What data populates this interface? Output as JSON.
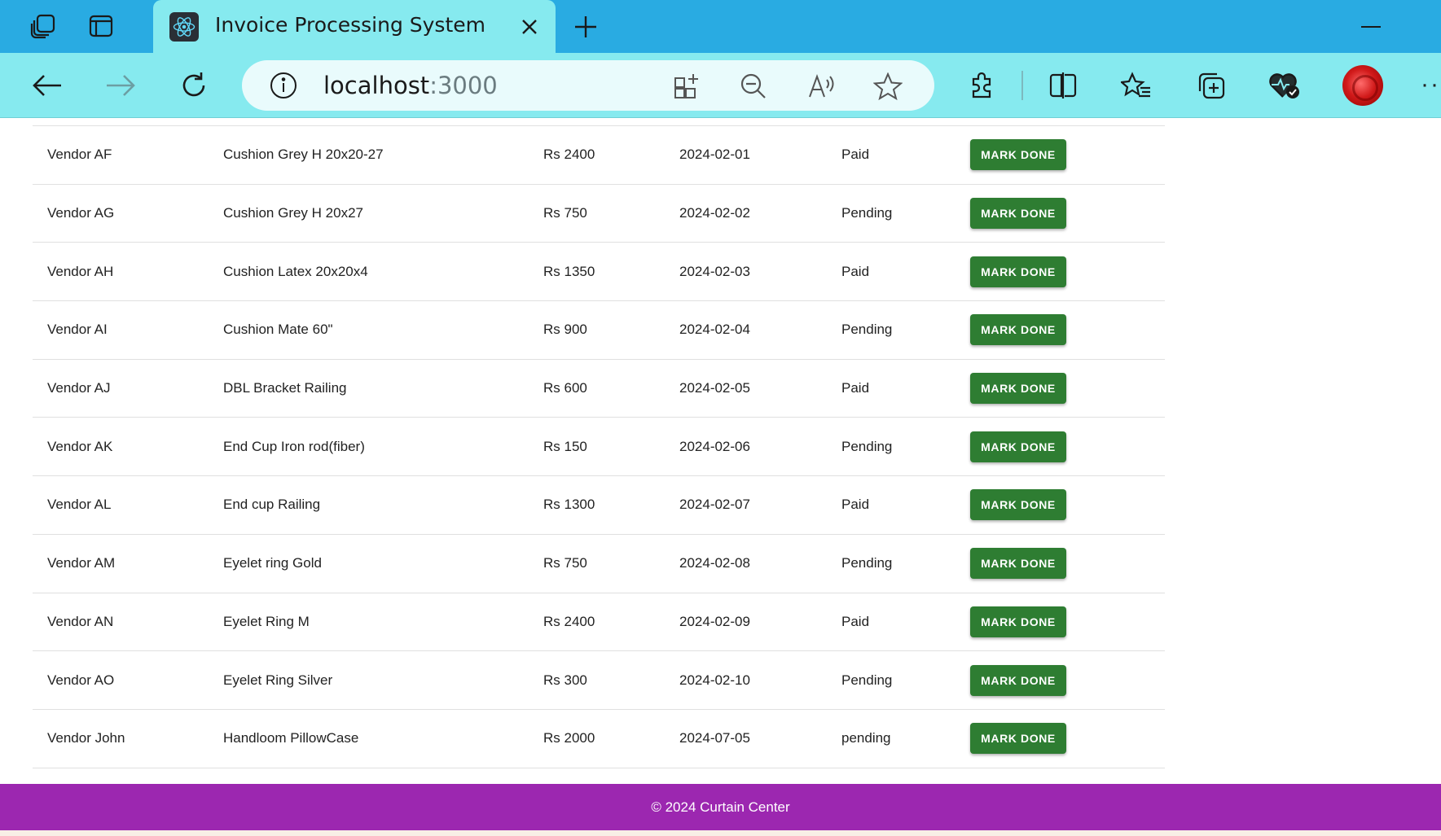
{
  "browser": {
    "tab_title": "Invoice Processing System",
    "url_host": "localhost",
    "url_port": ":3000"
  },
  "invoices": [
    {
      "vendor": "Vendor AF",
      "product": "Cushion Grey H 20x20-27",
      "amount": "Rs 2400",
      "date": "2024-02-01",
      "status": "Paid",
      "action": "MARK DONE"
    },
    {
      "vendor": "Vendor AG",
      "product": "Cushion Grey H 20x27",
      "amount": "Rs 750",
      "date": "2024-02-02",
      "status": "Pending",
      "action": "MARK DONE"
    },
    {
      "vendor": "Vendor AH",
      "product": "Cushion Latex 20x20x4",
      "amount": "Rs 1350",
      "date": "2024-02-03",
      "status": "Paid",
      "action": "MARK DONE"
    },
    {
      "vendor": "Vendor AI",
      "product": "Cushion Mate 60\"",
      "amount": "Rs 900",
      "date": "2024-02-04",
      "status": "Pending",
      "action": "MARK DONE"
    },
    {
      "vendor": "Vendor AJ",
      "product": "DBL Bracket Railing",
      "amount": "Rs 600",
      "date": "2024-02-05",
      "status": "Paid",
      "action": "MARK DONE"
    },
    {
      "vendor": "Vendor AK",
      "product": "End Cup Iron rod(fiber)",
      "amount": "Rs 150",
      "date": "2024-02-06",
      "status": "Pending",
      "action": "MARK DONE"
    },
    {
      "vendor": "Vendor AL",
      "product": "End cup Railing",
      "amount": "Rs 1300",
      "date": "2024-02-07",
      "status": "Paid",
      "action": "MARK DONE"
    },
    {
      "vendor": "Vendor AM",
      "product": "Eyelet ring Gold",
      "amount": "Rs 750",
      "date": "2024-02-08",
      "status": "Pending",
      "action": "MARK DONE"
    },
    {
      "vendor": "Vendor AN",
      "product": "Eyelet Ring M",
      "amount": "Rs 2400",
      "date": "2024-02-09",
      "status": "Paid",
      "action": "MARK DONE"
    },
    {
      "vendor": "Vendor AO",
      "product": "Eyelet Ring Silver",
      "amount": "Rs 300",
      "date": "2024-02-10",
      "status": "Pending",
      "action": "MARK DONE"
    },
    {
      "vendor": "Vendor John",
      "product": "Handloom PillowCase",
      "amount": "Rs 2000",
      "date": "2024-07-05",
      "status": "pending",
      "action": "MARK DONE"
    }
  ],
  "footer": {
    "text": "© 2024 Curtain Center"
  },
  "colors": {
    "tab_bar": "#29abe2",
    "toolbar": "#86eaef",
    "button": "#2e7d32",
    "footer": "#9c27b0"
  },
  "icons": [
    "workspaces-icon",
    "tab-actions-icon",
    "react-icon",
    "close-icon",
    "plus-icon",
    "minimize-icon",
    "back-icon",
    "forward-icon",
    "refresh-icon",
    "info-icon",
    "app-available-icon",
    "zoom-out-icon",
    "read-aloud-icon",
    "star-icon",
    "extensions-icon",
    "split-screen-icon",
    "favorites-icon",
    "collections-icon",
    "browser-essentials-icon",
    "more-icon"
  ]
}
